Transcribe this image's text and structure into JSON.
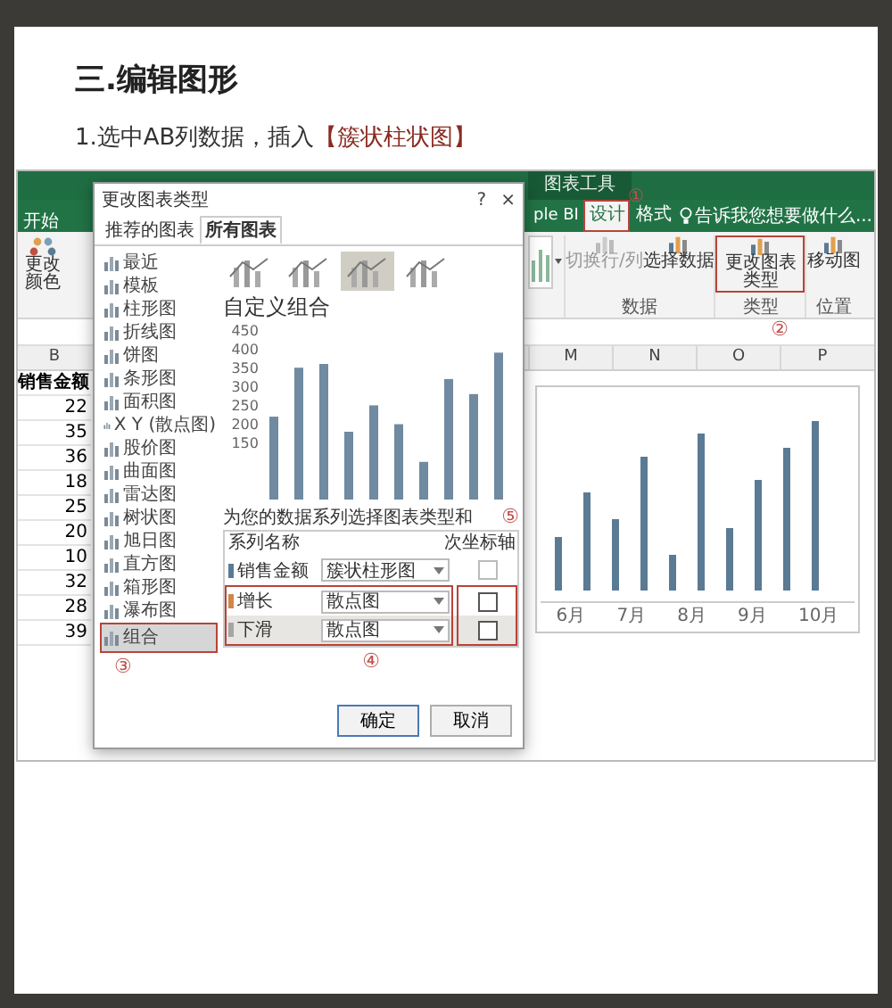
{
  "heading": "三.编辑图形",
  "step": {
    "text": "1.选中AB列数据，插入",
    "highlight": "【簇状柱状图】"
  },
  "excel": {
    "context_group": "图表工具",
    "tabs": [
      {
        "label": "开始",
        "selected": false,
        "highlighted": false
      },
      {
        "label": "ple BI",
        "selected": false,
        "highlighted": false
      },
      {
        "label": "设计",
        "selected": true,
        "highlighted": true
      },
      {
        "label": "格式",
        "selected": false,
        "highlighted": false
      }
    ],
    "tell_me": "告诉我您想要做什么...",
    "color_button": "更改颜色",
    "ribbon_groups": [
      {
        "label": "数据",
        "buttons": [
          {
            "label": "切换行/列",
            "disabled": true,
            "highlighted": false
          },
          {
            "label": "选择数据",
            "disabled": false,
            "highlighted": false
          }
        ]
      },
      {
        "label": "类型",
        "buttons": [
          {
            "label": "更改图表类型",
            "disabled": false,
            "highlighted": true
          }
        ]
      },
      {
        "label": "位置",
        "buttons": [
          {
            "label": "移动图",
            "disabled": false,
            "highlighted": false
          }
        ]
      }
    ],
    "callouts": [
      "①",
      "②",
      "③",
      "④",
      "⑤"
    ],
    "left_column": "B",
    "left_header": "销售金额",
    "left_values": [
      "22",
      "35",
      "36",
      "18",
      "25",
      "20",
      "10",
      "32",
      "28",
      "39"
    ],
    "right_columns": [
      "M",
      "N",
      "O",
      "P"
    ],
    "background_chart": {
      "x_labels": [
        "6月",
        "7月",
        "8月",
        "9月",
        "10月"
      ]
    }
  },
  "dialog": {
    "title": "更改图表类型",
    "help": "?",
    "close": "×",
    "tabs": [
      {
        "label": "推荐的图表",
        "selected": false
      },
      {
        "label": "所有图表",
        "selected": true
      }
    ],
    "chart_types": [
      {
        "label": "最近",
        "selected": false,
        "highlighted": false
      },
      {
        "label": "模板",
        "selected": false,
        "highlighted": false
      },
      {
        "label": "柱形图",
        "selected": false,
        "highlighted": false
      },
      {
        "label": "折线图",
        "selected": false,
        "highlighted": false
      },
      {
        "label": "饼图",
        "selected": false,
        "highlighted": false
      },
      {
        "label": "条形图",
        "selected": false,
        "highlighted": false
      },
      {
        "label": "面积图",
        "selected": false,
        "highlighted": false
      },
      {
        "label": "X Y (散点图)",
        "selected": false,
        "highlighted": false
      },
      {
        "label": "股价图",
        "selected": false,
        "highlighted": false
      },
      {
        "label": "曲面图",
        "selected": false,
        "highlighted": false
      },
      {
        "label": "雷达图",
        "selected": false,
        "highlighted": false
      },
      {
        "label": "树状图",
        "selected": false,
        "highlighted": false
      },
      {
        "label": "旭日图",
        "selected": false,
        "highlighted": false
      },
      {
        "label": "直方图",
        "selected": false,
        "highlighted": false
      },
      {
        "label": "箱形图",
        "selected": false,
        "highlighted": false
      },
      {
        "label": "瀑布图",
        "selected": false,
        "highlighted": false
      },
      {
        "label": "组合",
        "selected": true,
        "highlighted": true
      }
    ],
    "subtypes": [
      {
        "selected": false
      },
      {
        "selected": false
      },
      {
        "selected": true
      },
      {
        "selected": false
      }
    ],
    "subtype_title": "自定义组合",
    "preview_axis_labels": [
      "450",
      "400",
      "350",
      "300",
      "250",
      "200",
      "150"
    ],
    "series_prompt": "为您的数据系列选择图表类型和",
    "name_header": "系列名称",
    "axis_header": "次坐标轴",
    "series": [
      {
        "name": "销售金额",
        "color": "#5b7a94",
        "chart_type": "簇状柱形图",
        "secondary_axis": false,
        "disabled": true,
        "selected": false,
        "highlighted": false
      },
      {
        "name": "增长",
        "color": "#d0874a",
        "chart_type": "散点图",
        "secondary_axis": false,
        "disabled": false,
        "selected": false,
        "highlighted": true
      },
      {
        "name": "下滑",
        "color": "#a5a5a5",
        "chart_type": "散点图",
        "secondary_axis": false,
        "disabled": false,
        "selected": true,
        "highlighted": true
      }
    ],
    "buttons": [
      {
        "label": "确定",
        "default": true
      },
      {
        "label": "取消",
        "default": false
      }
    ]
  }
}
